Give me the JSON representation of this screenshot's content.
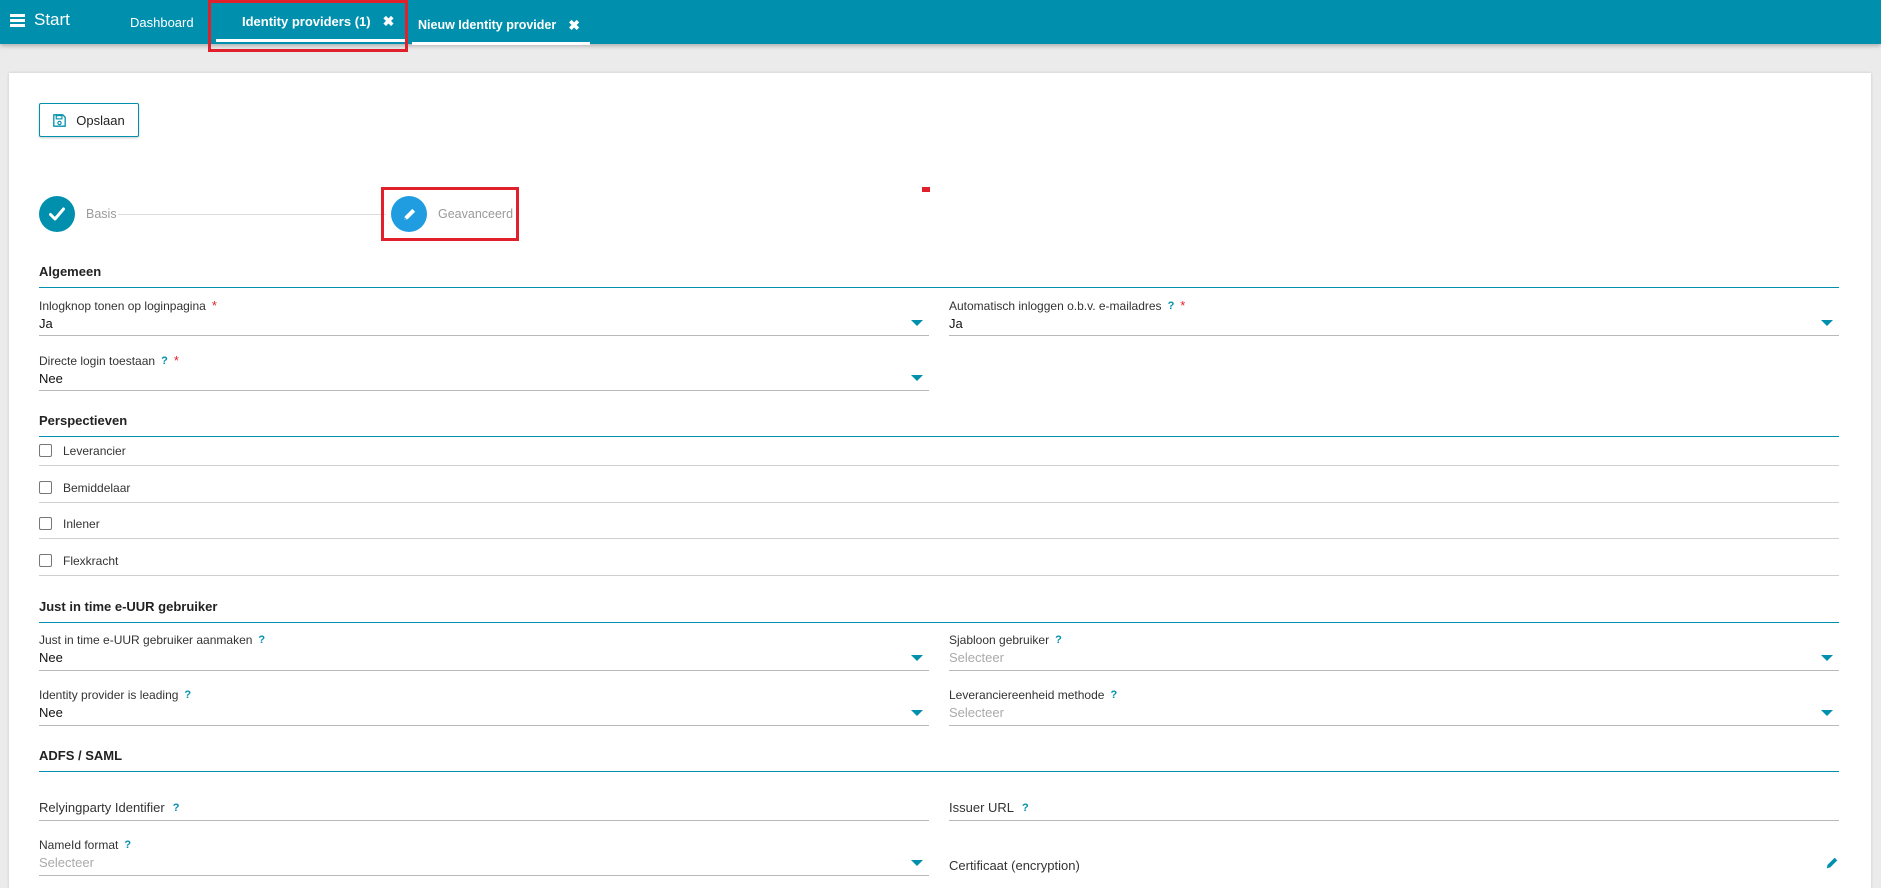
{
  "topbar": {
    "start_label": "Start",
    "tabs": [
      {
        "label": "Dashboard"
      },
      {
        "label": "Identity providers (1)",
        "close": "✖"
      },
      {
        "label": "Nieuw Identity provider",
        "close": "✖"
      }
    ]
  },
  "toolbar": {
    "save_label": "Opslaan",
    "save_icon": "floppy-disk-icon"
  },
  "stepper": {
    "steps": [
      {
        "label": "Basis",
        "icon": "check-icon",
        "state": "done"
      },
      {
        "label": "Geavanceerd",
        "icon": "pencil-icon",
        "state": "active"
      }
    ]
  },
  "sections": {
    "algemeen": {
      "title": "Algemeen",
      "inlogknop": {
        "label": "Inlogknop tonen op loginpagina",
        "required": "*",
        "value": "Ja"
      },
      "automatisch": {
        "label": "Automatisch inloggen o.b.v. e-mailadres",
        "help": "?",
        "required": "*",
        "value": "Ja"
      },
      "directe": {
        "label": "Directe login toestaan",
        "help": "?",
        "required": "*",
        "value": "Nee"
      }
    },
    "perspectieven": {
      "title": "Perspectieven",
      "items": [
        {
          "label": "Leverancier",
          "checked": false
        },
        {
          "label": "Bemiddelaar",
          "checked": false
        },
        {
          "label": "Inlener",
          "checked": false
        },
        {
          "label": "Flexkracht",
          "checked": false
        }
      ]
    },
    "jit": {
      "title": "Just in time e-UUR gebruiker",
      "aanmaken": {
        "label": "Just in time e-UUR gebruiker aanmaken",
        "help": "?",
        "value": "Nee"
      },
      "sjabloon": {
        "label": "Sjabloon gebruiker",
        "help": "?",
        "placeholder": "Selecteer"
      },
      "leading": {
        "label": "Identity provider is leading",
        "help": "?",
        "value": "Nee"
      },
      "methode": {
        "label": "Leveranciereenheid methode",
        "help": "?",
        "placeholder": "Selecteer"
      }
    },
    "adfs": {
      "title": "ADFS / SAML",
      "relying": {
        "label": "Relyingparty Identifier",
        "help": "?"
      },
      "issuer": {
        "label": "Issuer URL",
        "help": "?"
      },
      "nameid": {
        "label": "NameId format",
        "help": "?",
        "placeholder": "Selecteer"
      },
      "certificaat": {
        "label": "Certificaat (encryption)",
        "icon": "pencil-icon"
      }
    }
  },
  "colors": {
    "brand": "#0090ad",
    "highlight": "#e0212b",
    "active_step": "#1f9de0"
  }
}
